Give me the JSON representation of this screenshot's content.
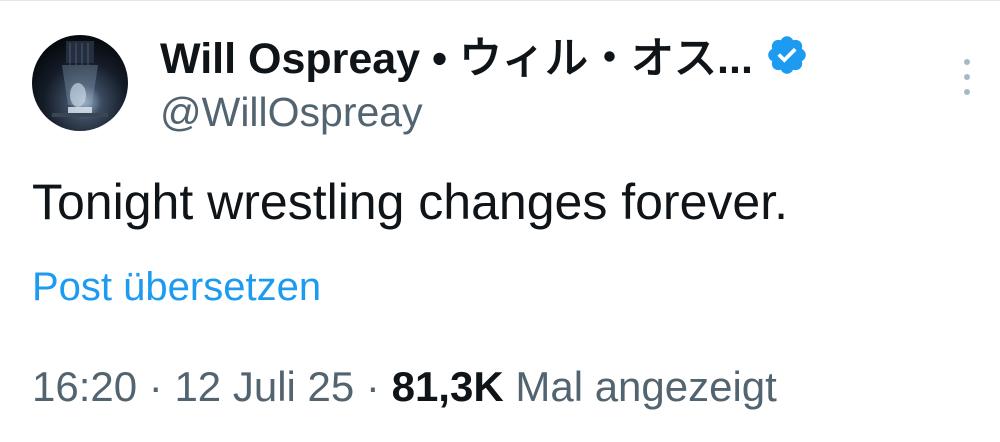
{
  "author": {
    "display_name": "Will Ospreay • ウィル・オス...",
    "handle": "@WillOspreay",
    "verified": true,
    "verified_color": "#1d9bf0"
  },
  "post": {
    "text": "Tonight wrestling changes forever.",
    "translate_label": "Post übersetzen"
  },
  "meta": {
    "time": "16:20",
    "separator": "·",
    "date": "12 Juli 25",
    "views_count": "81,3K",
    "views_label": "Mal angezeigt"
  },
  "colors": {
    "link": "#1d9bf0",
    "secondary_text": "#536471",
    "primary_text": "#0f1419"
  }
}
